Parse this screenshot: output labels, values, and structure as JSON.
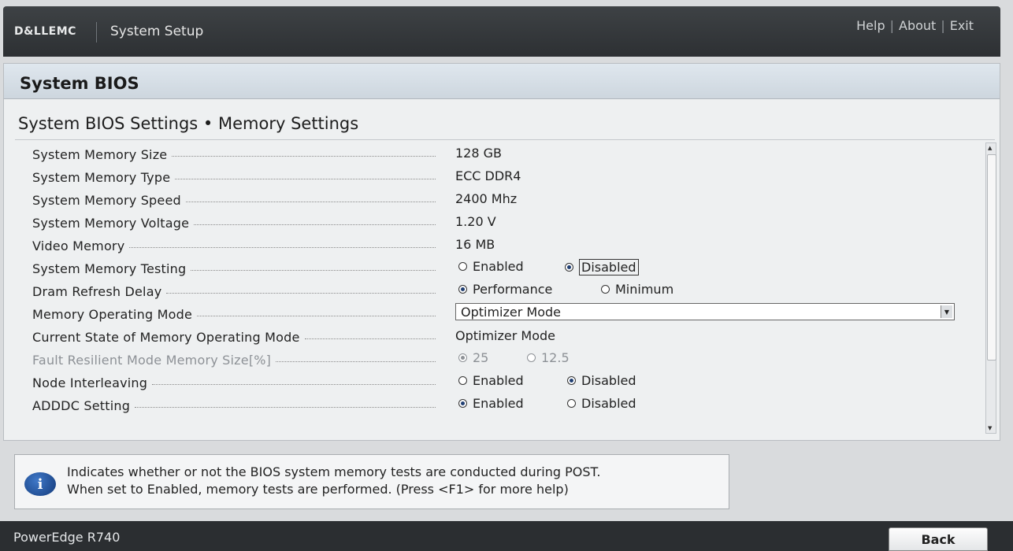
{
  "header": {
    "logo": "D&LLEMC",
    "app_title": "System Setup",
    "links": [
      "Help",
      "About",
      "Exit"
    ]
  },
  "page": {
    "title": "System BIOS",
    "breadcrumb": "System BIOS Settings • Memory Settings"
  },
  "settings": [
    {
      "label": "System Memory Size",
      "value": "128 GB"
    },
    {
      "label": "System Memory Type",
      "value": "ECC DDR4"
    },
    {
      "label": "System Memory Speed",
      "value": "2400 Mhz"
    },
    {
      "label": "System Memory Voltage",
      "value": "1.20 V"
    },
    {
      "label": "Video Memory",
      "value": "16 MB"
    },
    {
      "label": "System Memory Testing",
      "options": [
        "Enabled",
        "Disabled"
      ],
      "selected": "Disabled"
    },
    {
      "label": "Dram Refresh Delay",
      "options": [
        "Performance",
        "Minimum"
      ],
      "selected": "Performance"
    },
    {
      "label": "Memory Operating Mode",
      "select_value": "Optimizer Mode"
    },
    {
      "label": "Current State of Memory Operating Mode",
      "value": "Optimizer Mode"
    },
    {
      "label": "Fault Resilient Mode Memory Size[%]",
      "options": [
        "25",
        "12.5"
      ],
      "selected": "25",
      "disabled": true
    },
    {
      "label": "Node Interleaving",
      "options": [
        "Enabled",
        "Disabled"
      ],
      "selected": "Disabled"
    },
    {
      "label": "ADDDC Setting",
      "options": [
        "Enabled",
        "Disabled"
      ],
      "selected": "Enabled"
    }
  ],
  "help": {
    "line1": "Indicates whether or not the BIOS system memory tests are conducted during POST.",
    "line2": "When set to Enabled, memory tests are performed. (Press <F1> for more help)",
    "icon": "info-icon"
  },
  "footer": {
    "model": "PowerEdge R740",
    "back_label": "Back"
  }
}
